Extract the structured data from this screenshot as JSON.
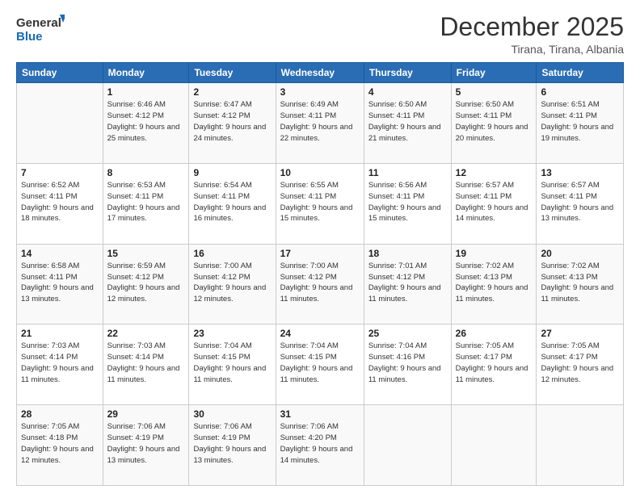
{
  "logo": {
    "general": "General",
    "blue": "Blue"
  },
  "header": {
    "title": "December 2025",
    "subtitle": "Tirana, Tirana, Albania"
  },
  "weekdays": [
    "Sunday",
    "Monday",
    "Tuesday",
    "Wednesday",
    "Thursday",
    "Friday",
    "Saturday"
  ],
  "weeks": [
    [
      null,
      {
        "day": 1,
        "sunrise": "6:46 AM",
        "sunset": "4:12 PM",
        "daylight": "9 hours and 25 minutes."
      },
      {
        "day": 2,
        "sunrise": "6:47 AM",
        "sunset": "4:12 PM",
        "daylight": "9 hours and 24 minutes."
      },
      {
        "day": 3,
        "sunrise": "6:49 AM",
        "sunset": "4:11 PM",
        "daylight": "9 hours and 22 minutes."
      },
      {
        "day": 4,
        "sunrise": "6:50 AM",
        "sunset": "4:11 PM",
        "daylight": "9 hours and 21 minutes."
      },
      {
        "day": 5,
        "sunrise": "6:50 AM",
        "sunset": "4:11 PM",
        "daylight": "9 hours and 20 minutes."
      },
      {
        "day": 6,
        "sunrise": "6:51 AM",
        "sunset": "4:11 PM",
        "daylight": "9 hours and 19 minutes."
      }
    ],
    [
      {
        "day": 7,
        "sunrise": "6:52 AM",
        "sunset": "4:11 PM",
        "daylight": "9 hours and 18 minutes."
      },
      {
        "day": 8,
        "sunrise": "6:53 AM",
        "sunset": "4:11 PM",
        "daylight": "9 hours and 17 minutes."
      },
      {
        "day": 9,
        "sunrise": "6:54 AM",
        "sunset": "4:11 PM",
        "daylight": "9 hours and 16 minutes."
      },
      {
        "day": 10,
        "sunrise": "6:55 AM",
        "sunset": "4:11 PM",
        "daylight": "9 hours and 15 minutes."
      },
      {
        "day": 11,
        "sunrise": "6:56 AM",
        "sunset": "4:11 PM",
        "daylight": "9 hours and 15 minutes."
      },
      {
        "day": 12,
        "sunrise": "6:57 AM",
        "sunset": "4:11 PM",
        "daylight": "9 hours and 14 minutes."
      },
      {
        "day": 13,
        "sunrise": "6:57 AM",
        "sunset": "4:11 PM",
        "daylight": "9 hours and 13 minutes."
      }
    ],
    [
      {
        "day": 14,
        "sunrise": "6:58 AM",
        "sunset": "4:11 PM",
        "daylight": "9 hours and 13 minutes."
      },
      {
        "day": 15,
        "sunrise": "6:59 AM",
        "sunset": "4:12 PM",
        "daylight": "9 hours and 12 minutes."
      },
      {
        "day": 16,
        "sunrise": "7:00 AM",
        "sunset": "4:12 PM",
        "daylight": "9 hours and 12 minutes."
      },
      {
        "day": 17,
        "sunrise": "7:00 AM",
        "sunset": "4:12 PM",
        "daylight": "9 hours and 11 minutes."
      },
      {
        "day": 18,
        "sunrise": "7:01 AM",
        "sunset": "4:12 PM",
        "daylight": "9 hours and 11 minutes."
      },
      {
        "day": 19,
        "sunrise": "7:02 AM",
        "sunset": "4:13 PM",
        "daylight": "9 hours and 11 minutes."
      },
      {
        "day": 20,
        "sunrise": "7:02 AM",
        "sunset": "4:13 PM",
        "daylight": "9 hours and 11 minutes."
      }
    ],
    [
      {
        "day": 21,
        "sunrise": "7:03 AM",
        "sunset": "4:14 PM",
        "daylight": "9 hours and 11 minutes."
      },
      {
        "day": 22,
        "sunrise": "7:03 AM",
        "sunset": "4:14 PM",
        "daylight": "9 hours and 11 minutes."
      },
      {
        "day": 23,
        "sunrise": "7:04 AM",
        "sunset": "4:15 PM",
        "daylight": "9 hours and 11 minutes."
      },
      {
        "day": 24,
        "sunrise": "7:04 AM",
        "sunset": "4:15 PM",
        "daylight": "9 hours and 11 minutes."
      },
      {
        "day": 25,
        "sunrise": "7:04 AM",
        "sunset": "4:16 PM",
        "daylight": "9 hours and 11 minutes."
      },
      {
        "day": 26,
        "sunrise": "7:05 AM",
        "sunset": "4:17 PM",
        "daylight": "9 hours and 11 minutes."
      },
      {
        "day": 27,
        "sunrise": "7:05 AM",
        "sunset": "4:17 PM",
        "daylight": "9 hours and 12 minutes."
      }
    ],
    [
      {
        "day": 28,
        "sunrise": "7:05 AM",
        "sunset": "4:18 PM",
        "daylight": "9 hours and 12 minutes."
      },
      {
        "day": 29,
        "sunrise": "7:06 AM",
        "sunset": "4:19 PM",
        "daylight": "9 hours and 13 minutes."
      },
      {
        "day": 30,
        "sunrise": "7:06 AM",
        "sunset": "4:19 PM",
        "daylight": "9 hours and 13 minutes."
      },
      {
        "day": 31,
        "sunrise": "7:06 AM",
        "sunset": "4:20 PM",
        "daylight": "9 hours and 14 minutes."
      },
      null,
      null,
      null
    ]
  ],
  "labels": {
    "sunrise": "Sunrise:",
    "sunset": "Sunset:",
    "daylight": "Daylight:"
  }
}
